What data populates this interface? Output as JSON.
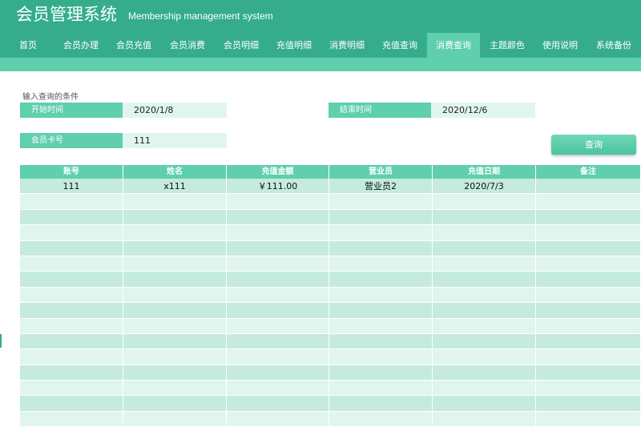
{
  "header": {
    "title": "会员管理系统",
    "subtitle": "Membership management system"
  },
  "nav": {
    "items": [
      {
        "label": "首页"
      },
      {
        "label": "会员办理"
      },
      {
        "label": "会员充值"
      },
      {
        "label": "会员消费"
      },
      {
        "label": "会员明细"
      },
      {
        "label": "充值明细"
      },
      {
        "label": "消费明细"
      },
      {
        "label": "充值查询"
      },
      {
        "label": "消费查询",
        "active": true
      },
      {
        "label": "主题颜色"
      },
      {
        "label": "使用说明"
      },
      {
        "label": "系统备份"
      }
    ]
  },
  "query": {
    "section_label": "输入查询的条件",
    "start_label": "开始时间",
    "start_value": "2020/1/8",
    "end_label": "结束时间",
    "end_value": "2020/12/6",
    "card_label": "会员卡号",
    "card_value": "111",
    "button_label": "查询"
  },
  "table": {
    "columns": [
      "账号",
      "姓名",
      "充值金额",
      "营业员",
      "充值日期",
      "备注"
    ],
    "rows": [
      [
        "111",
        "x111",
        "￥111.00",
        "营业员2",
        "2020/7/3",
        ""
      ]
    ],
    "empty_rows": 15
  },
  "colors": {
    "header_bg": "#35ad8c",
    "accent": "#5fcfae",
    "row_light": "#e0f5ef",
    "row_mid": "#c4ebdd"
  }
}
